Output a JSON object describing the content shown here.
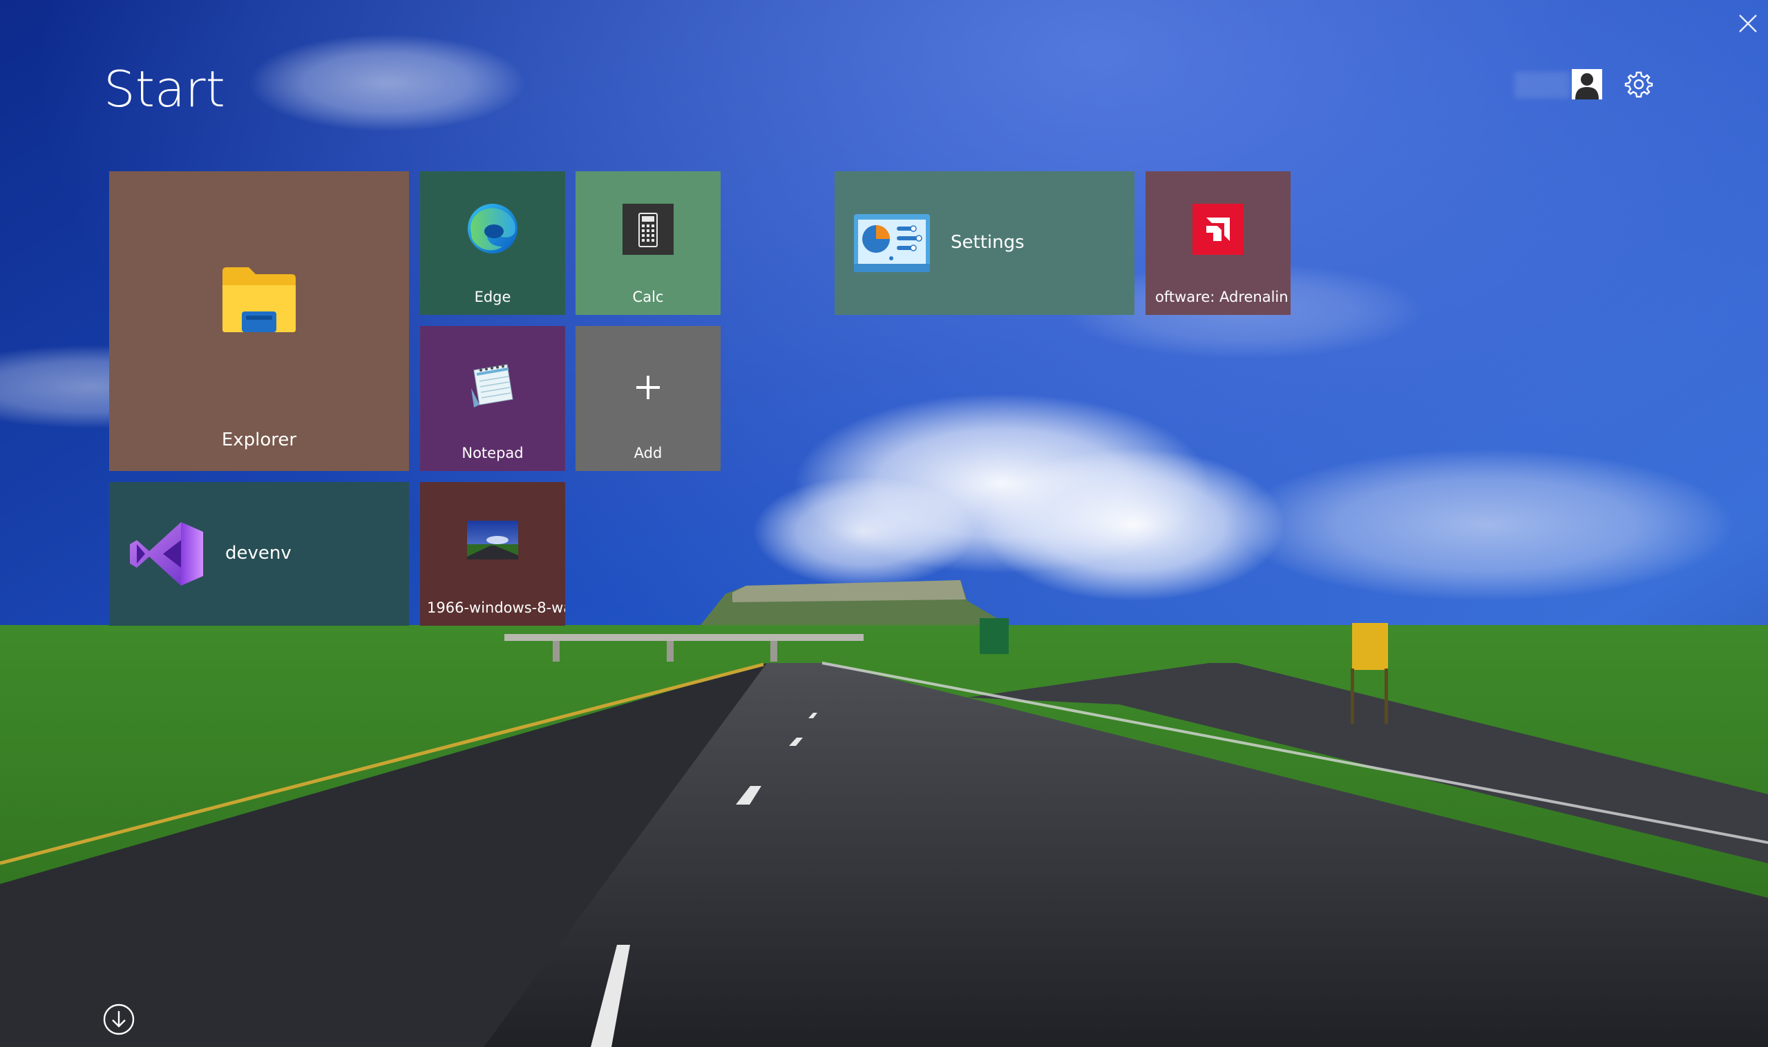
{
  "header": {
    "title": "Start"
  },
  "colors": {
    "explorer_tile": "#7a5a4e",
    "edge_tile": "#2c5e50",
    "calc_tile": "#5c9470",
    "notepad_tile": "#5d2f6a",
    "add_tile": "#6b6b6b",
    "devenv_tile": "#284f55",
    "wallpaper_tile": "#5a3030",
    "settings_tile": "#4f7a74",
    "amd_tile": "#6e4a58"
  },
  "tiles": {
    "explorer": {
      "label": "Explorer",
      "icon": "folder-icon"
    },
    "edge": {
      "label": "Edge",
      "icon": "edge-icon"
    },
    "calc": {
      "label": "Calc",
      "icon": "calculator-icon"
    },
    "notepad": {
      "label": "Notepad",
      "icon": "notepad-icon"
    },
    "add": {
      "label": "Add",
      "icon": "plus-icon"
    },
    "devenv": {
      "label": "devenv",
      "icon": "visual-studio-icon"
    },
    "wallpaper": {
      "label": "1966-windows-8-wa",
      "icon": "image-thumbnail-icon"
    },
    "settings": {
      "label": "Settings",
      "icon": "control-panel-icon"
    },
    "amd": {
      "label": "oftware: Adrenalin I",
      "icon": "amd-icon"
    }
  },
  "controls": {
    "user_icon": "user-icon",
    "settings_icon": "gear-icon",
    "close_icon": "close-icon",
    "scroll_icon": "arrow-down-circle-icon"
  }
}
